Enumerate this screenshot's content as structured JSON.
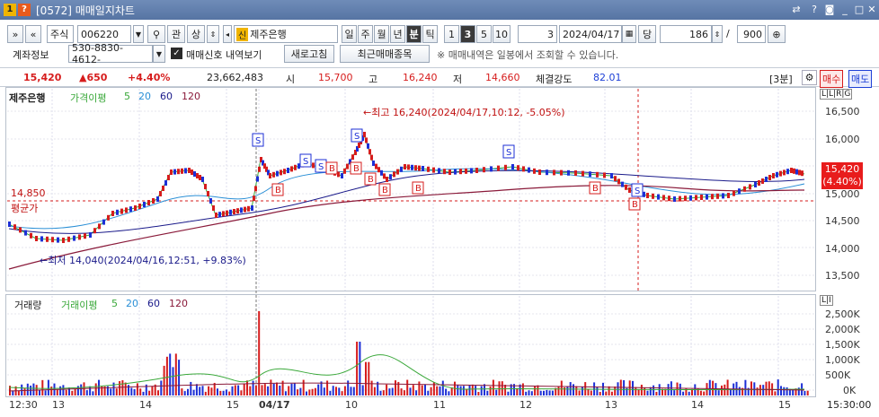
{
  "window": {
    "badge_num": "1",
    "badge_help": "?",
    "title": "[0572] 매매일지차트"
  },
  "toolbar": {
    "market": "주식",
    "code": "006220",
    "btn_ref": "관",
    "btn_up": "상",
    "stock_badge": "신",
    "stock_name": "제주은행",
    "periods": [
      "일",
      "주",
      "월",
      "년",
      "분",
      "틱"
    ],
    "selected_period": "분",
    "intervals": [
      "1",
      "3",
      "5",
      "10"
    ],
    "selected_interval": "3",
    "count_value": "3",
    "date": "2024/04/17",
    "btn_dang": "당",
    "qty": "186",
    "slash": "/",
    "total": "900"
  },
  "toolbar2": {
    "account_label": "계좌정보",
    "account": "530-8830-4612-",
    "checkbox_label": "매매신호 내역보기",
    "refresh": "새로고침",
    "recent": "최근매매종목",
    "notice": "※ 매매내역은 일봉에서 조회할 수 있습니다."
  },
  "quote": {
    "price": "15,420",
    "change": "▲650",
    "pct": "+4.40%",
    "volume": "23,662,483",
    "open_l": "시",
    "open": "15,700",
    "high_l": "고",
    "high": "16,240",
    "low_l": "저",
    "low": "14,660",
    "str_l": "체결강도",
    "strength": "82.01",
    "interval_btn": "[3분]",
    "buy": "매수",
    "sell": "매도"
  },
  "price_panel": {
    "name": "제주은행",
    "ma_label": "가격이평",
    "ma": [
      "5",
      "20",
      "60",
      "120"
    ],
    "scale_mode": "L|L|R|G",
    "scale": [
      "16,500",
      "16,000",
      "15,500",
      "15,000",
      "14,500",
      "14,000",
      "13,500"
    ],
    "avg_price": "14,850",
    "avg_label": "평균가",
    "high_note": "←최고 16,240(2024/04/17,10:12, -5.05%)",
    "low_note": "←최저 14,040(2024/04/16,12:51, +9.83%)",
    "last_price": "15,420",
    "last_pct": "(4.40%)"
  },
  "volume_panel": {
    "name": "거래량",
    "ma_label": "거래이평",
    "ma": [
      "5",
      "20",
      "60",
      "120"
    ],
    "scale_mode": "L|I",
    "scale": [
      "2,500K",
      "2,000K",
      "1,500K",
      "1,000K",
      "500K",
      "0K"
    ]
  },
  "xaxis": {
    "labels": [
      "12:30",
      "13",
      "14",
      "15",
      "04/17",
      "10",
      "11",
      "12",
      "13",
      "14",
      "15"
    ],
    "end": "15:30:00"
  },
  "colors": {
    "up": "#d61c1c",
    "down": "#1c2fd6",
    "ma5": "#3aa83a",
    "ma20": "#2a8fd6",
    "ma60": "#1a1a8a",
    "ma120": "#8a1a3a"
  }
}
